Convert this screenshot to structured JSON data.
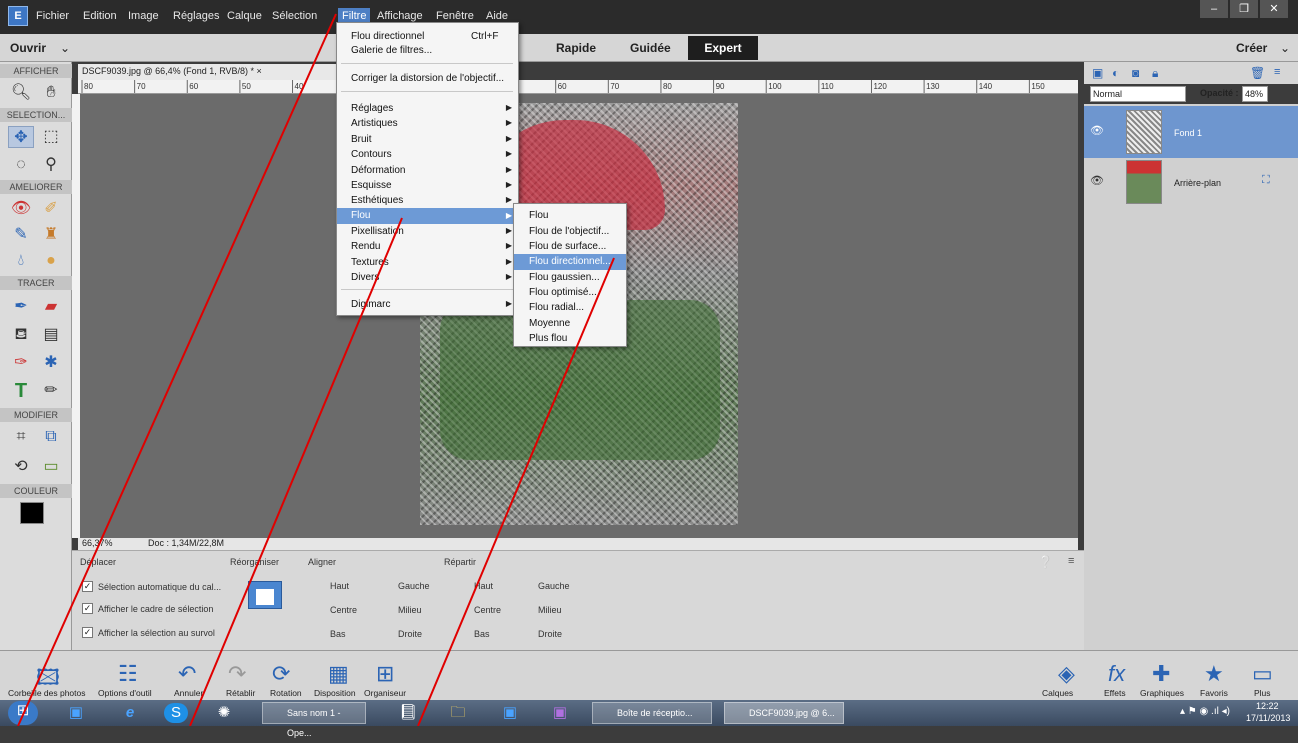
{
  "menubar": {
    "logo_text": "E",
    "items": [
      "Fichier",
      "Edition",
      "Image",
      "Réglages",
      "Calque",
      "Sélection",
      "Filtre",
      "Affichage",
      "Fenêtre",
      "Aide"
    ],
    "active_item": "Filtre"
  },
  "modebar": {
    "open_label": "Ouvrir",
    "modes": [
      "Rapide",
      "Guidée",
      "Expert"
    ],
    "active_mode": "Expert",
    "create_label": "Créer"
  },
  "toolbox": {
    "sections": [
      "AFFICHER",
      "SELECTION...",
      "AMELIORER",
      "TRACER",
      "MODIFIER",
      "COULEUR"
    ]
  },
  "document": {
    "tab_title": "DSCF9039.jpg @ 66,4% (Fond 1, RVB/8) * ×",
    "zoom": "66,37%",
    "doc_size": "Doc : 1,34M/22,8M",
    "ruler_labels": [
      "80",
      "70",
      "60",
      "50",
      "40",
      "30",
      "30",
      "40",
      "50",
      "60",
      "70",
      "80",
      "90",
      "100",
      "110",
      "120",
      "130",
      "140",
      "150"
    ]
  },
  "filter_menu": {
    "top_items": [
      {
        "label": "Flou directionnel",
        "shortcut": "Ctrl+F"
      },
      {
        "label": "Galerie de filtres..."
      }
    ],
    "lens": "Corriger la distorsion de l'objectif...",
    "sub_items": [
      "Réglages",
      "Artistiques",
      "Bruit",
      "Contours",
      "Déformation",
      "Esquisse",
      "Esthétiques",
      "Flou",
      "Pixellisation",
      "Rendu",
      "Textures",
      "Divers"
    ],
    "highlighted": "Flou",
    "bottom": "Digimarc"
  },
  "flou_submenu": {
    "items": [
      "Flou",
      "Flou de l'objectif...",
      "Flou de surface...",
      "Flou directionnel...",
      "Flou gaussien...",
      "Flou optimisé...",
      "Flou radial...",
      "Moyenne",
      "Plus flou"
    ],
    "highlighted": "Flou directionnel..."
  },
  "options": {
    "tool_name": "Déplacer",
    "checks": [
      {
        "label": "Sélection automatique du cal...",
        "checked": true
      },
      {
        "label": "Afficher le cadre de sélection",
        "checked": true
      },
      {
        "label": "Afficher la sélection au survol",
        "checked": true
      }
    ],
    "reorganiser": "Réorganiser",
    "aligner": {
      "title": "Aligner",
      "items": [
        "Haut",
        "Gauche",
        "Centre",
        "Milieu",
        "Bas",
        "Droite"
      ]
    },
    "repartir": {
      "title": "Répartir",
      "items": [
        "Haut",
        "Gauche",
        "Centre",
        "Milieu",
        "Bas",
        "Droite"
      ]
    }
  },
  "layers": {
    "blend_mode": "Normal",
    "opacity_label": "Opacité :",
    "opacity": "48%",
    "items": [
      {
        "name": "Fond 1",
        "selected": true
      },
      {
        "name": "Arrière-plan",
        "selected": false
      }
    ]
  },
  "bottombar": {
    "left": [
      "Corbeille des photos",
      "Options d'outil",
      "Annuler",
      "Rétablir",
      "Rotation",
      "Disposition",
      "Organiseur"
    ],
    "right": [
      "Calques",
      "Effets",
      "Graphiques",
      "Favoris",
      "Plus"
    ]
  },
  "taskbar": {
    "tasks": [
      "Sans nom 1 - Ope...",
      "Boîte de réceptio...",
      "DSCF9039.jpg @ 6..."
    ],
    "time": "12:22",
    "date": "17/11/2013"
  },
  "colors": {
    "accent": "#6d9ad6",
    "annotation": "#e00000"
  }
}
